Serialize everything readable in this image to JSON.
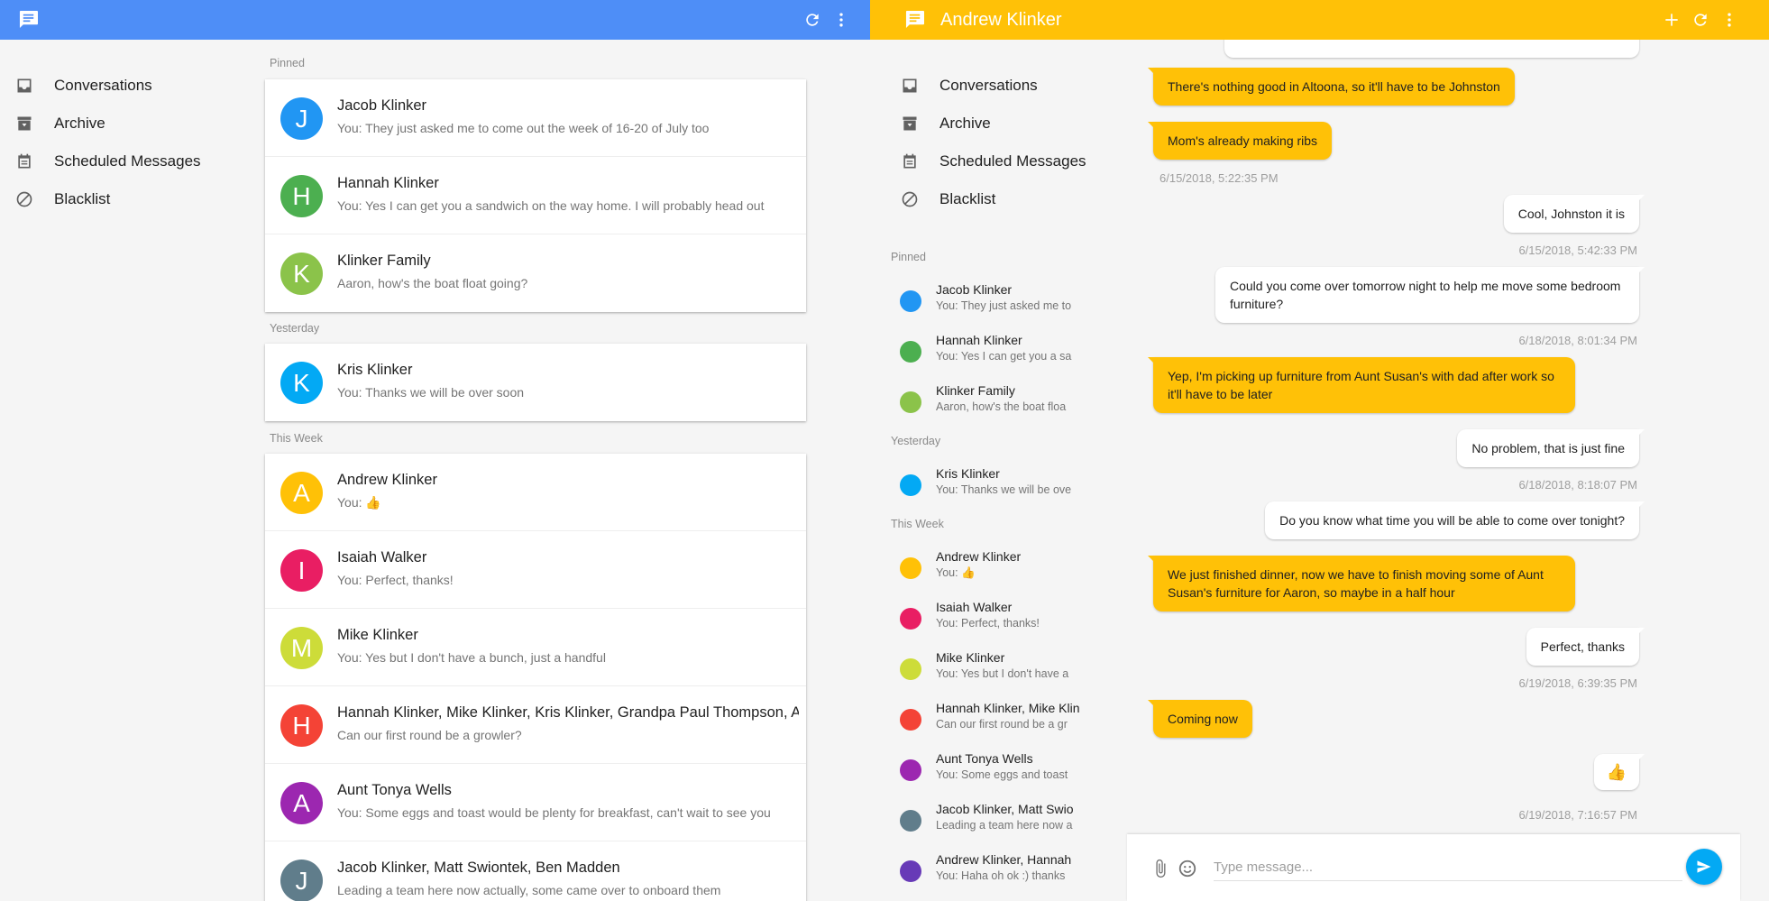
{
  "colors": {
    "primary_left": "#4e8ef7",
    "primary_right": "#ffc107",
    "accent_send": "#03a9f4"
  },
  "left": {
    "toolbar": {
      "refresh_icon": "refresh-icon",
      "menu_icon": "more-vert-icon",
      "logo_icon": "message-icon"
    },
    "nav": [
      {
        "label": "Conversations",
        "icon": "inbox-icon"
      },
      {
        "label": "Archive",
        "icon": "archive-icon"
      },
      {
        "label": "Scheduled Messages",
        "icon": "calendar-icon"
      },
      {
        "label": "Blacklist",
        "icon": "block-icon"
      }
    ],
    "sections": {
      "pinned": "Pinned",
      "yesterday": "Yesterday",
      "this_week": "This Week"
    },
    "pinned": [
      {
        "name": "Jacob Klinker",
        "snippet": "You: They just asked me to come out the week of 16-20 of July too",
        "letter": "J",
        "color": "#2196f3"
      },
      {
        "name": "Hannah Klinker",
        "snippet": "You: Yes I can get you a sandwich on the way home. I will probably head out",
        "letter": "H",
        "color": "#4caf50"
      },
      {
        "name": "Klinker Family",
        "snippet": "Aaron, how's the boat float going?",
        "letter": "K",
        "color": "#8bc34a"
      }
    ],
    "yesterday": [
      {
        "name": "Kris Klinker",
        "snippet": "You: Thanks we will be over soon",
        "letter": "K",
        "color": "#03a9f4"
      }
    ],
    "this_week": [
      {
        "name": "Andrew Klinker",
        "snippet": "You: 👍",
        "letter": "A",
        "color": "#ffc107"
      },
      {
        "name": "Isaiah Walker",
        "snippet": "You: Perfect, thanks!",
        "letter": "I",
        "color": "#e91e63"
      },
      {
        "name": "Mike Klinker",
        "snippet": "You: Yes but I don't have a bunch, just a handful",
        "letter": "M",
        "color": "#cddc39"
      },
      {
        "name": "Hannah Klinker, Mike Klinker, Kris Klinker, Grandpa Paul Thompson, Al",
        "snippet": "Can our first round be a growler?",
        "letter": "H",
        "color": "#f44336"
      },
      {
        "name": "Aunt Tonya Wells",
        "snippet": "You: Some eggs and toast would be plenty for breakfast, can't wait to see you",
        "letter": "A",
        "color": "#9c27b0"
      },
      {
        "name": "Jacob Klinker, Matt Swiontek, Ben Madden",
        "snippet": "Leading a team here now actually, some came over to onboard them",
        "letter": "J",
        "color": "#607d8b"
      }
    ]
  },
  "right": {
    "toolbar": {
      "title": "Andrew Klinker",
      "add_icon": "add-icon",
      "refresh_icon": "refresh-icon",
      "menu_icon": "more-vert-icon"
    },
    "nav": [
      {
        "label": "Conversations"
      },
      {
        "label": "Archive"
      },
      {
        "label": "Scheduled Messages"
      },
      {
        "label": "Blacklist"
      }
    ],
    "sections": {
      "pinned": "Pinned",
      "yesterday": "Yesterday",
      "this_week": "This Week"
    },
    "pinned": [
      {
        "name": "Jacob Klinker",
        "snippet": "You: They just asked me to",
        "color": "#2196f3"
      },
      {
        "name": "Hannah Klinker",
        "snippet": "You: Yes I can get you a sa",
        "color": "#4caf50"
      },
      {
        "name": "Klinker Family",
        "snippet": "Aaron, how's the boat floa",
        "color": "#8bc34a"
      }
    ],
    "yesterday": [
      {
        "name": "Kris Klinker",
        "snippet": "You: Thanks we will be ove",
        "color": "#03a9f4"
      }
    ],
    "this_week": [
      {
        "name": "Andrew Klinker",
        "snippet": "You: 👍",
        "color": "#ffc107"
      },
      {
        "name": "Isaiah Walker",
        "snippet": "You: Perfect, thanks!",
        "color": "#e91e63"
      },
      {
        "name": "Mike Klinker",
        "snippet": "You: Yes but I don't have a",
        "color": "#cddc39"
      },
      {
        "name": "Hannah Klinker, Mike Klin",
        "snippet": "Can our first round be a gr",
        "color": "#f44336"
      },
      {
        "name": "Aunt Tonya Wells",
        "snippet": "You: Some eggs and toast",
        "color": "#9c27b0"
      },
      {
        "name": "Jacob Klinker, Matt Swio",
        "snippet": "Leading a team here now a",
        "color": "#607d8b"
      },
      {
        "name": "Andrew Klinker, Hannah",
        "snippet": "You: Haha oh ok :) thanks",
        "color": "#673ab7"
      }
    ],
    "messages": [
      {
        "text": "There's nothing good in Altoona, so it'll have to be Johnston",
        "dir": "in"
      },
      {
        "text": "Mom's already making ribs",
        "dir": "in",
        "time": "6/15/2018, 5:22:35 PM"
      },
      {
        "text": "Cool, Johnston it is",
        "dir": "out",
        "time": "6/15/2018, 5:42:33 PM"
      },
      {
        "text": "Could you come over tomorrow night to help me move some bedroom furniture?",
        "dir": "out",
        "time": "6/18/2018, 8:01:34 PM"
      },
      {
        "text": "Yep, I'm picking up furniture from Aunt Susan's with dad after work so it'll have to be later",
        "dir": "in"
      },
      {
        "text": "No problem, that is just fine",
        "dir": "out",
        "time": "6/18/2018, 8:18:07 PM"
      },
      {
        "text": "Do you know what time you will be able to come over tonight?",
        "dir": "out"
      },
      {
        "text": "We just finished dinner, now we have to finish moving some of Aunt Susan's furniture for Aaron, so maybe in a half hour",
        "dir": "in"
      },
      {
        "text": "Perfect, thanks",
        "dir": "out",
        "time": "6/19/2018, 6:39:35 PM"
      },
      {
        "text": "Coming now",
        "dir": "in"
      },
      {
        "text": "👍",
        "dir": "out",
        "time": "6/19/2018, 7:16:57 PM"
      }
    ],
    "composer": {
      "placeholder": "Type message...",
      "attach_icon": "attach-icon",
      "emoji_icon": "emoji-icon",
      "send_icon": "send-icon"
    }
  }
}
